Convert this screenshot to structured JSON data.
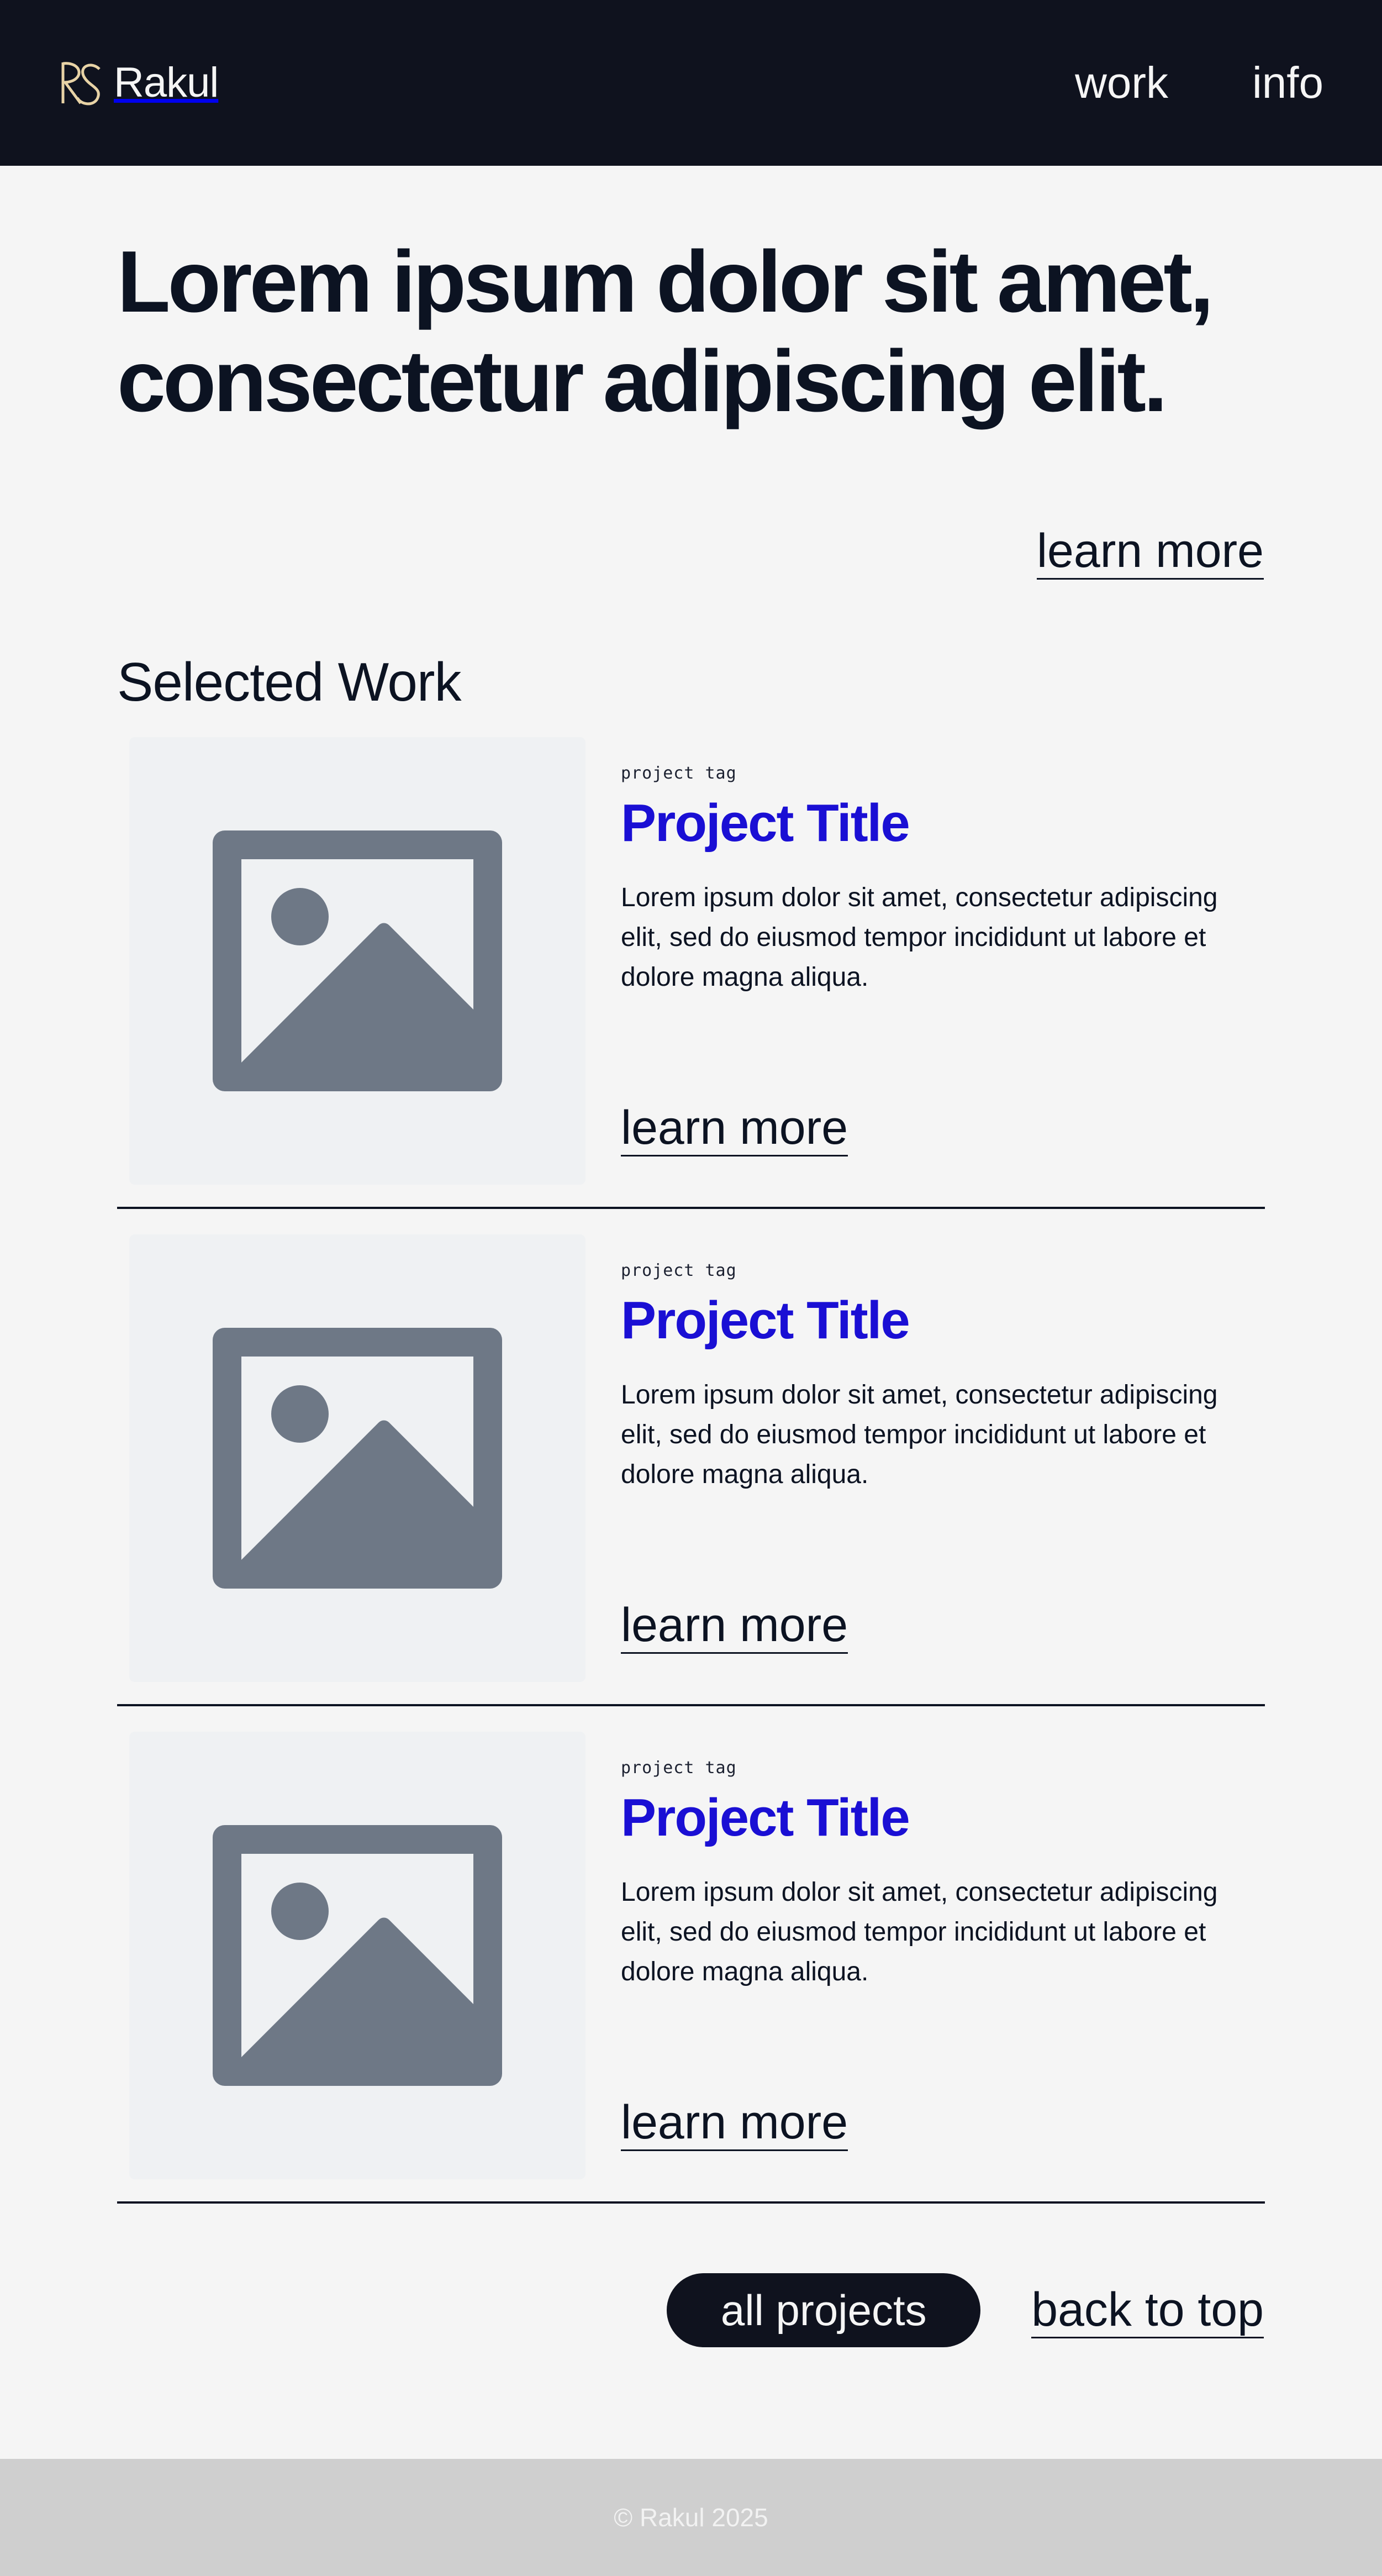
{
  "header": {
    "brand": "Rakul",
    "nav": [
      {
        "label": "work"
      },
      {
        "label": "info"
      }
    ]
  },
  "hero": {
    "title_line1": "Lorem ipsum dolor sit amet,",
    "title_line2": "consectetur adipiscing elit.",
    "link_label": "learn more"
  },
  "section": {
    "title": "Selected Work"
  },
  "projects": [
    {
      "tag": "project tag",
      "title": "Project Title",
      "description": "Lorem ipsum dolor sit amet, consectetur adipiscing elit, sed do eiusmod tempor incididunt ut labore et dolore magna aliqua.",
      "link_label": "learn more",
      "thumb_icon": "image-placeholder-icon"
    },
    {
      "tag": "project tag",
      "title": "Project Title",
      "description": "Lorem ipsum dolor sit amet, consectetur adipiscing elit, sed do eiusmod tempor incididunt ut labore et dolore magna aliqua.",
      "link_label": "learn more",
      "thumb_icon": "image-placeholder-icon"
    },
    {
      "tag": "project tag",
      "title": "Project Title",
      "description": "Lorem ipsum dolor sit amet, consectetur adipiscing elit, sed do eiusmod tempor incididunt ut labore et dolore magna aliqua.",
      "link_label": "learn more",
      "thumb_icon": "image-placeholder-icon"
    }
  ],
  "actions": {
    "all_projects": "all projects",
    "back_to_top": "back to top"
  },
  "footer": {
    "copyright": "© Rakul 2025"
  },
  "colors": {
    "header_bg": "#0f121e",
    "page_bg": "#f5f5f5",
    "text": "#0c1322",
    "accent": "#1a0fd4",
    "thumb_bg": "#eff1f3",
    "thumb_icon": "#6e7886",
    "footer_bg": "#cfcfcf",
    "logo_gold": "#e8d3a6"
  }
}
